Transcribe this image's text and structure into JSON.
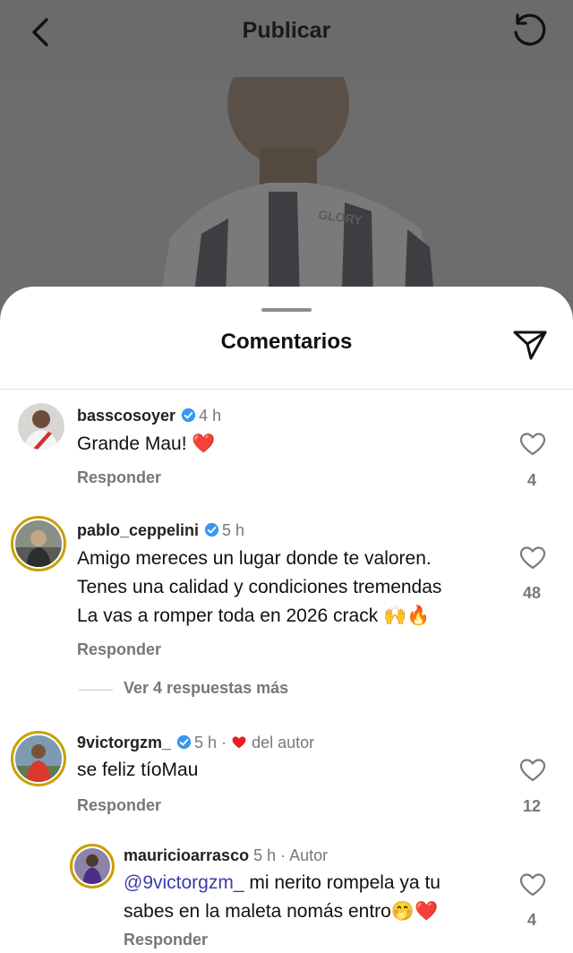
{
  "header": {
    "title": "Publicar"
  },
  "sheet": {
    "title": "Comentarios"
  },
  "comments": [
    {
      "username": "basscosoyer",
      "time": "4 h",
      "lines": [
        "Grande Mau! ❤️"
      ],
      "reply_label": "Responder",
      "likes": "4"
    },
    {
      "username": "pablo_ceppelini",
      "time": "5 h",
      "lines": [
        "Amigo mereces un lugar donde te valoren.",
        "Tenes una calidad y condiciones tremendas",
        "La vas a romper toda en 2026 crack 🙌🔥"
      ],
      "reply_label": "Responder",
      "likes": "48",
      "more_replies": "Ver 4 respuestas más"
    },
    {
      "username": "9victorgzm_",
      "time": "5 h",
      "author_like": "del autor",
      "lines": [
        "se feliz tíoMau"
      ],
      "reply_label": "Responder",
      "likes": "12"
    },
    {
      "username": "mauricioarrasco",
      "time": "5 h",
      "author_tag": "· Autor",
      "mention": "@9victorgzm_",
      "line1_rest": " mi nerito rompela ya tu",
      "line2": "sabes en la maleta nomás entro🤭❤️",
      "reply_label": "Responder",
      "likes": "4"
    }
  ],
  "colors": {
    "verified": "#3897f0",
    "heart_red": "#ed1c24",
    "story_ring": "#c9a000",
    "mention": "#3c3ca8"
  },
  "icons": [
    "back-arrow-icon",
    "refresh-icon",
    "send-icon",
    "verified-badge-icon",
    "heart-outline-icon"
  ]
}
